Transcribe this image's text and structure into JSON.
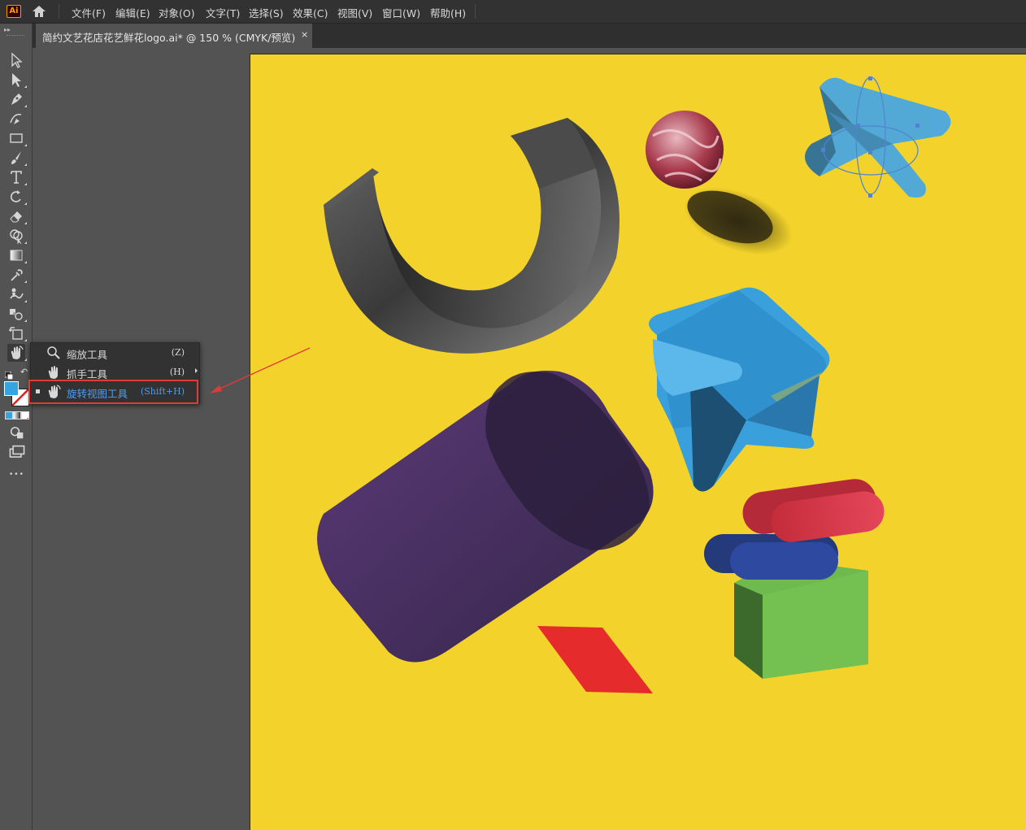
{
  "app": {
    "logo_text": "Ai"
  },
  "menu": [
    "文件(F)",
    "编辑(E)",
    "对象(O)",
    "文字(T)",
    "选择(S)",
    "效果(C)",
    "视图(V)",
    "窗口(W)",
    "帮助(H)"
  ],
  "document_tab": {
    "title": "简约文艺花店花艺鲜花logo.ai* @ 150 % (CMYK/预览)",
    "close": "×"
  },
  "toolbar": {
    "tools": [
      "selection-tool-icon",
      "direct-selection-tool-icon",
      "pen-tool-icon",
      "curvature-tool-icon",
      "rectangle-tool-icon",
      "paintbrush-tool-icon",
      "type-tool-icon",
      "rotate-tool-icon",
      "eraser-tool-icon",
      "shape-builder-tool-icon",
      "gradient-tool-icon",
      "eyedropper-tool-icon",
      "puppet-warp-tool-icon",
      "blend-tool-icon",
      "artboard-tool-icon",
      "rotate-view-tool-icon"
    ],
    "more": "•••",
    "fill_color": "#35a4e0"
  },
  "flyout": {
    "items": [
      {
        "label": "缩放工具",
        "shortcut": "(Z)",
        "icon": "zoom-icon"
      },
      {
        "label": "抓手工具",
        "shortcut": "(H)",
        "icon": "hand-icon"
      },
      {
        "label": "旋转视图工具",
        "shortcut": "(Shift+H)",
        "icon": "rotate-view-icon"
      }
    ],
    "active_index": 2
  },
  "colors": {
    "artboard": "#f3d32b",
    "highlight": "#e03a3a",
    "active_text": "#4d9cf0"
  }
}
